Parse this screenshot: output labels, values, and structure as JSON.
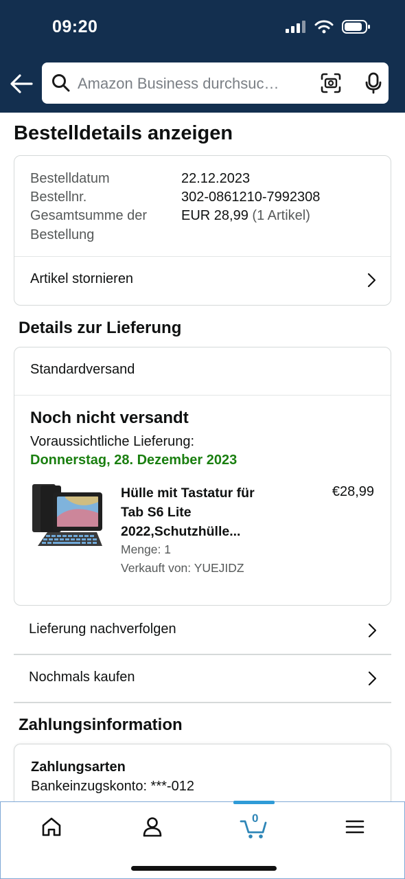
{
  "status_bar": {
    "time": "09:20"
  },
  "search": {
    "placeholder": "Amazon Business durchsuc…"
  },
  "page": {
    "title": "Bestelldetails anzeigen"
  },
  "summary": {
    "order_date_label": "Bestelldatum",
    "order_date": "22.12.2023",
    "order_number_label": "Bestellnr.",
    "order_number": "302-0861210-7992308",
    "total_label_line1": "Gesamtsumme der",
    "total_label_line2": "Bestellung",
    "total_value": "EUR 28,99",
    "total_items": "(1 Artikel)",
    "cancel_label": "Artikel stornieren"
  },
  "delivery": {
    "section_title": "Details zur Lieferung",
    "shipping_method": "Standardversand",
    "status": "Noch nicht versandt",
    "expected_label": "Voraussichtliche Lieferung:",
    "expected_date": "Donnerstag, 28. Dezember 2023",
    "expected_date_color": "#1a7f10",
    "product": {
      "title_line1": "Hülle mit Tastatur für",
      "title_line2": "Tab S6 Lite",
      "title_line3": "2022,Schutzhülle...",
      "price": "€28,99",
      "quantity": "Menge: 1",
      "seller": "Verkauft von: YUEJIDZ"
    }
  },
  "actions": {
    "track": "Lieferung nachverfolgen",
    "buy_again": "Nochmals kaufen"
  },
  "payment": {
    "section_title": "Zahlungsinformation",
    "methods_label": "Zahlungsarten",
    "method_value": "Bankeinzugskonto: ***-012"
  },
  "bottom_nav": {
    "items": [
      "home-icon",
      "account-icon",
      "cart-icon",
      "menu-icon"
    ],
    "cart_count": "0",
    "active": "cart",
    "accent_color": "#2f9bd7"
  },
  "colors": {
    "header_bg": "#132f4f"
  }
}
